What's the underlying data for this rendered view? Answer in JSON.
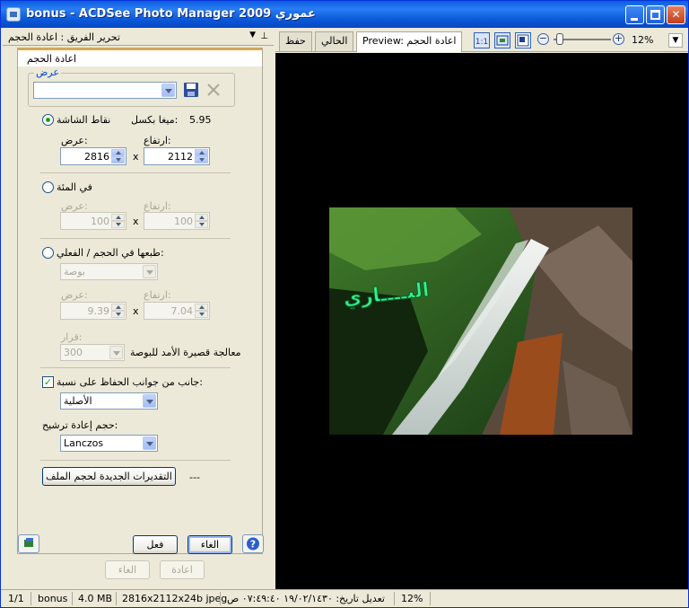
{
  "window": {
    "title": "bonus - ACDSee Photo Manager 2009 عموري"
  },
  "panel": {
    "header": "تحرير الفريق : اعادة الحجم",
    "section_title": "اعادة الحجم",
    "presets_legend": "عرض",
    "pixels": {
      "label": "نقاط الشاشة",
      "megapixel_label": "ميغا بكسل:",
      "megapixel_value": "5.95",
      "width_label": "عرض:",
      "height_label": "ارتفاع:",
      "width": "2816",
      "height": "2112",
      "times": "x"
    },
    "percent": {
      "label": "في المئة",
      "width_label": "عرض:",
      "height_label": "ارتفاع:",
      "width": "100",
      "height": "100",
      "times": "x"
    },
    "actual": {
      "label": "طبعها في الحجم / الفعلي:",
      "unit": "بوصة",
      "width_label": "عرض:",
      "height_label": "ارتفاع:",
      "width": "9.39",
      "height": "7.04",
      "times": "x",
      "resolution_label": "قرار:",
      "resolution": "300",
      "resolution_unit": "معالجة قصيرة الأمد للبوصة"
    },
    "aspect": {
      "label": "جانب من جوانب الحفاظ على نسبة:",
      "value": "الأصلية"
    },
    "filter": {
      "label": "حجم إعادة ترشيح:",
      "value": "Lanczos"
    },
    "estimate_button": "التقديرات الجديدة لحجم الملف",
    "estimate_value": "---",
    "apply_button": "فعل",
    "cancel_button": "الغاء",
    "undo_button": "الغاء",
    "redo_button": "اعادة"
  },
  "tabs": [
    {
      "label": "حفظ"
    },
    {
      "label": "الحالي"
    },
    {
      "label": "Preview: اعادة الحجم"
    }
  ],
  "zoom": {
    "value": "12%",
    "level": 0.06
  },
  "photo": {
    "overlay_text": "البــــاري"
  },
  "status": {
    "counter": "1/1",
    "file": "bonus",
    "size": "4.0 MB",
    "dims": "2816x2112x24b jpeg",
    "modified": "تعديل تاريخ: ١٩/٠٢/١٤٣٠ ٠٧:٤٩:٤٠ ص",
    "zoom": "12%"
  },
  "colors": {
    "accent": "#0a5ee0",
    "viewer_bg": "#000000",
    "tab_accent": "#f5a623"
  }
}
